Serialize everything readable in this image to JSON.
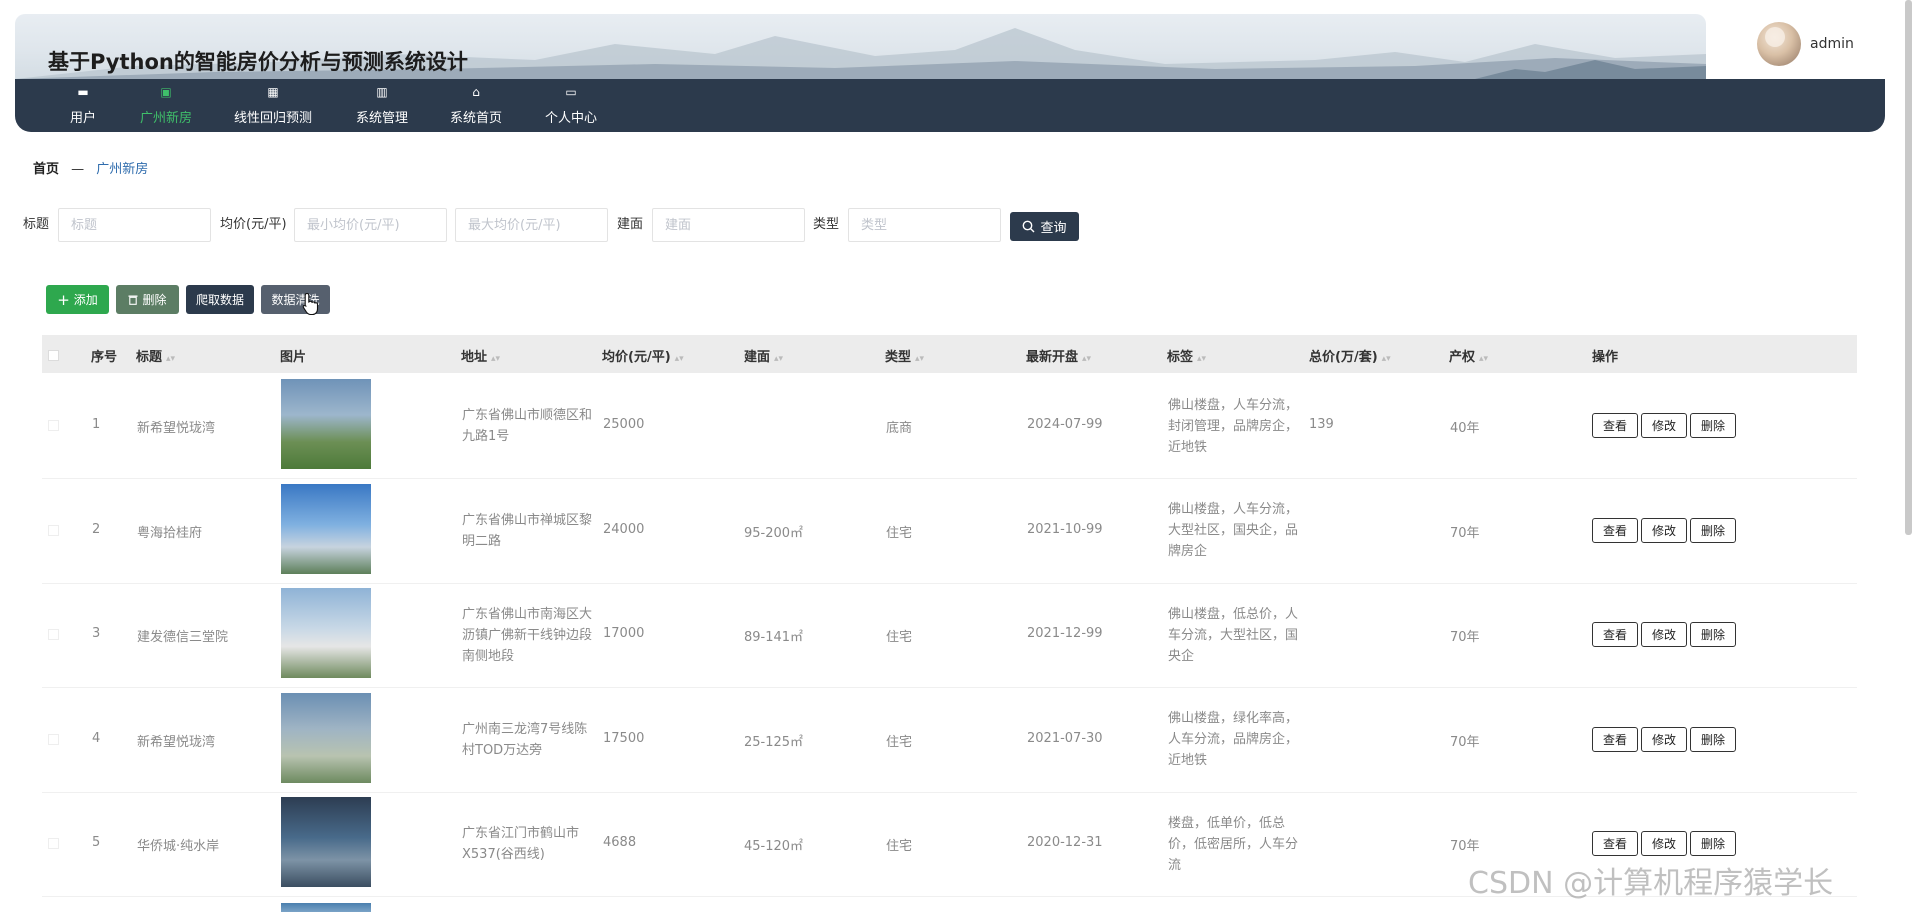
{
  "header": {
    "title": "基于Python的智能房价分析与预测系统设计",
    "user": "admin"
  },
  "nav": [
    {
      "label": "用户",
      "icon": "briefcase-icon",
      "glyph": "▬",
      "active": false
    },
    {
      "label": "广州新房",
      "icon": "calendar-check-icon",
      "glyph": "▣",
      "active": true
    },
    {
      "label": "线性回归预测",
      "icon": "grid-icon",
      "glyph": "▦",
      "active": false
    },
    {
      "label": "系统管理",
      "icon": "bar-icon",
      "glyph": "▥",
      "active": false
    },
    {
      "label": "系统首页",
      "icon": "home-icon",
      "glyph": "⌂",
      "active": false
    },
    {
      "label": "个人中心",
      "icon": "card-icon",
      "glyph": "▭",
      "active": false
    }
  ],
  "breadcrumb": {
    "home": "首页",
    "separator": "—",
    "current": "广州新房"
  },
  "search": {
    "title_label": "标题",
    "title_placeholder": "标题",
    "price_label": "均价(元/平)",
    "min_price_placeholder": "最小均价(元/平)",
    "max_price_placeholder": "最大均价(元/平)",
    "area_label": "建面",
    "area_placeholder": "建面",
    "type_label": "类型",
    "type_placeholder": "类型",
    "query_button": "查询"
  },
  "actions": {
    "add": "添加",
    "delete": "删除",
    "crawl": "爬取数据",
    "clean": "数据清洗"
  },
  "table": {
    "headers": {
      "index": "序号",
      "title": "标题",
      "image": "图片",
      "address": "地址",
      "price": "均价(元/平)",
      "area": "建面",
      "type": "类型",
      "open": "最新开盘",
      "tags": "标签",
      "total": "总价(万/套)",
      "rights": "产权",
      "ops": "操作"
    },
    "op_labels": {
      "view": "查看",
      "edit": "修改",
      "delete": "删除"
    },
    "rows": [
      {
        "index": "1",
        "title": "新希望悦珑湾",
        "address": "广东省佛山市顺德区和九路1号",
        "price": "25000",
        "area": "",
        "type": "底商",
        "open": "2024-07-99",
        "tags": "佛山楼盘，人车分流，封闭管理，品牌房企，近地铁",
        "total": "139",
        "rights": "40年"
      },
      {
        "index": "2",
        "title": "粤海拾桂府",
        "address": "广东省佛山市禅城区黎明二路",
        "price": "24000",
        "area": "95-200㎡",
        "type": "住宅",
        "open": "2021-10-99",
        "tags": "佛山楼盘，人车分流，大型社区，国央企，品牌房企",
        "total": "",
        "rights": "70年"
      },
      {
        "index": "3",
        "title": "建发德信三堂院",
        "address": "广东省佛山市南海区大沥镇广佛新干线钟边段南侧地段",
        "price": "17000",
        "area": "89-141㎡",
        "type": "住宅",
        "open": "2021-12-99",
        "tags": "佛山楼盘，低总价，人车分流，大型社区，国央企",
        "total": "",
        "rights": "70年"
      },
      {
        "index": "4",
        "title": "新希望悦珑湾",
        "address": "广州南三龙湾7号线陈村TOD万达旁",
        "price": "17500",
        "area": "25-125㎡",
        "type": "住宅",
        "open": "2021-07-30",
        "tags": "佛山楼盘，绿化率高，人车分流，品牌房企，近地铁",
        "total": "",
        "rights": "70年"
      },
      {
        "index": "5",
        "title": "华侨城·纯水岸",
        "address": "广东省江门市鹤山市X537(谷西线)",
        "price": "4688",
        "area": "45-120㎡",
        "type": "住宅",
        "open": "2020-12-31",
        "tags": "楼盘，低单价，低总价，低密居所，人车分流",
        "total": "",
        "rights": "70年"
      }
    ]
  },
  "watermark": "CSDN @计算机程序猿学长",
  "colors": {
    "nav_bg": "#2c3a4c",
    "active": "#3fbf6a",
    "add_btn": "#2ea84e",
    "delete_btn": "#5c7d64",
    "crawl_btn": "#2c3a4c",
    "clean_btn": "#56606e"
  }
}
